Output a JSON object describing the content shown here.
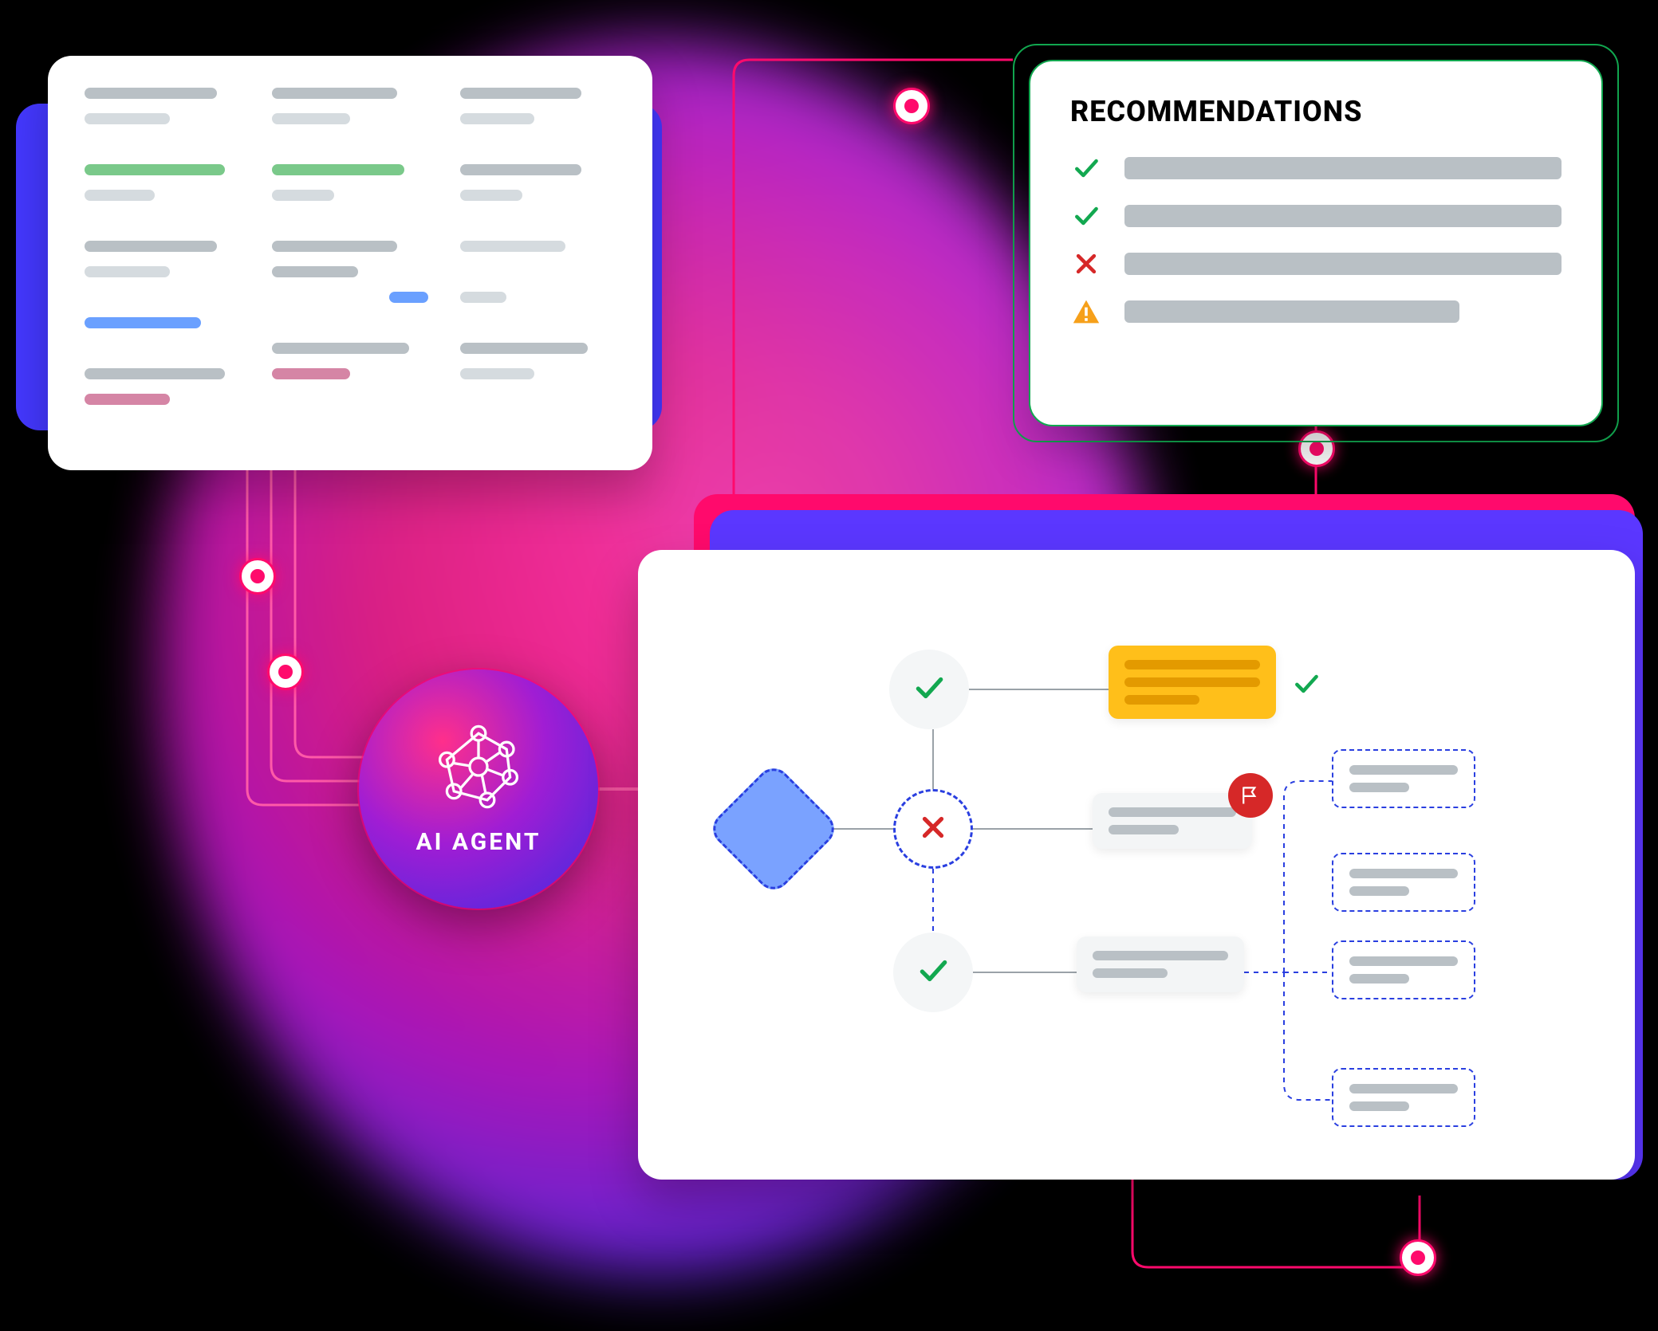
{
  "agent_label": "AI AGENT",
  "recommendations": {
    "title": "RECOMMENDATIONS",
    "items": [
      {
        "status": "ok"
      },
      {
        "status": "ok"
      },
      {
        "status": "fail"
      },
      {
        "status": "warn"
      }
    ]
  },
  "colors": {
    "accent_pink": "#ff0a6c",
    "accent_purple": "#5b37ff",
    "ok": "#12a850",
    "fail": "#d62828",
    "warn": "#f6a01a"
  }
}
